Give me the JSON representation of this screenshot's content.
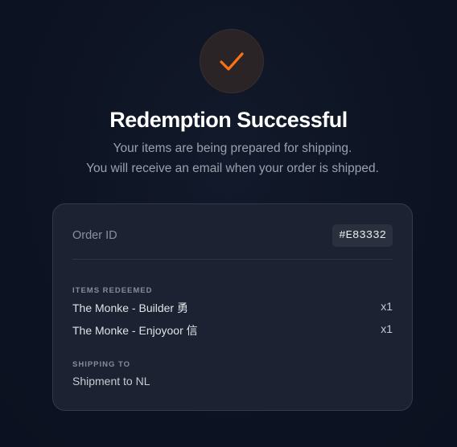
{
  "icon": {
    "name": "checkmark-icon",
    "color": "#f97316"
  },
  "title": "Redemption Successful",
  "subtitle": {
    "line1": "Your items are being prepared for shipping.",
    "line2": "You will receive an email when your order is shipped."
  },
  "order": {
    "label": "Order ID",
    "id": "#E83332"
  },
  "items_section": {
    "label": "ITEMS REDEEMED",
    "items": [
      {
        "name": "The Monke - Builder 勇",
        "qty": "x1"
      },
      {
        "name": "The Monke - Enjoyoor 信",
        "qty": "x1"
      }
    ]
  },
  "shipping_section": {
    "label": "SHIPPING TO",
    "value": "Shipment to NL"
  },
  "colors": {
    "accent": "#f97316",
    "background": "#0d1322",
    "card": "#1c2231"
  }
}
